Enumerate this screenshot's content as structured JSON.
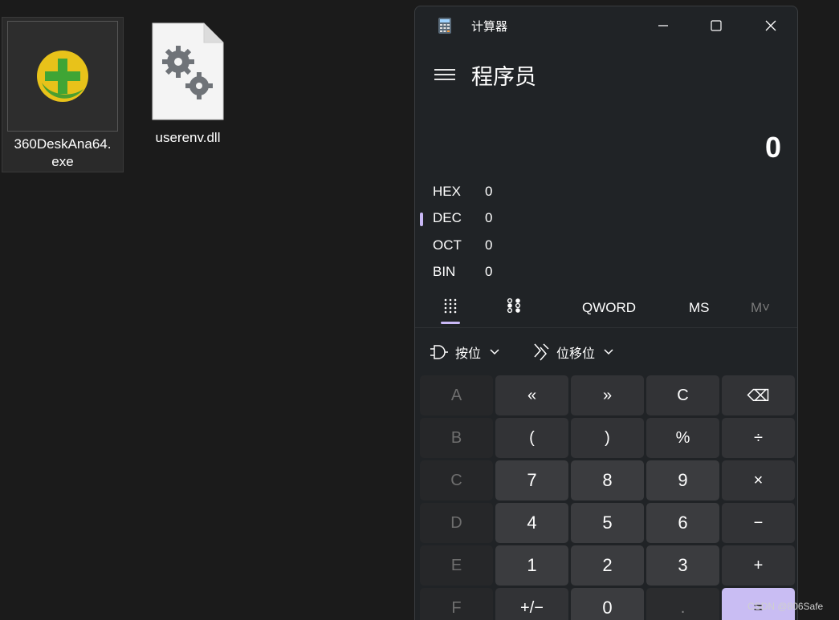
{
  "desktop": {
    "icons": [
      {
        "label": "360DeskAna64.\nexe"
      },
      {
        "label": "userenv.dll"
      }
    ]
  },
  "calculator": {
    "title": "计算器",
    "mode": "程序员",
    "display": "0",
    "radix": [
      {
        "name": "HEX",
        "value": "0"
      },
      {
        "name": "DEC",
        "value": "0"
      },
      {
        "name": "OCT",
        "value": "0"
      },
      {
        "name": "BIN",
        "value": "0"
      }
    ],
    "active_radix": "DEC",
    "word_size": "QWORD",
    "memory_store": "MS",
    "memory_view": "M˅",
    "bitwise_label": "按位",
    "bitshift_label": "位移位",
    "keys": [
      "A",
      "«",
      "»",
      "C",
      "⌫",
      "B",
      "(",
      ")",
      "%",
      "÷",
      "C",
      "7",
      "8",
      "9",
      "×",
      "D",
      "4",
      "5",
      "6",
      "−",
      "E",
      "1",
      "2",
      "3",
      "+",
      "F",
      "+/−",
      "0",
      ".",
      "="
    ],
    "accent_color": "#c9bdf3"
  },
  "watermark": "CSDN @806Safe"
}
